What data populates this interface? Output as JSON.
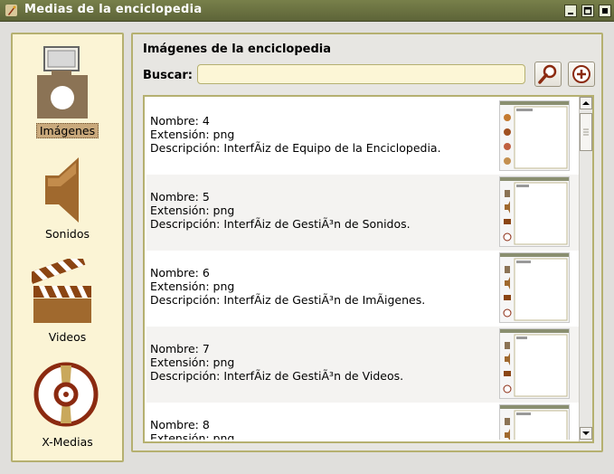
{
  "window": {
    "title": "Medias de la enciclopedia"
  },
  "sidebar": {
    "items": [
      {
        "label": "Imágenes",
        "icon": "camera-icon",
        "active": true
      },
      {
        "label": "Sonidos",
        "icon": "speaker-icon",
        "active": false
      },
      {
        "label": "Videos",
        "icon": "clapperboard-icon",
        "active": false
      },
      {
        "label": "X-Medias",
        "icon": "disc-icon",
        "active": false
      }
    ]
  },
  "main": {
    "title": "Imágenes de la enciclopedia",
    "search": {
      "label": "Buscar:",
      "value": "",
      "search_icon": "search-icon",
      "add_icon": "add-icon"
    },
    "list": [
      {
        "name": "Nombre: 4",
        "ext": "Extensión: png",
        "desc": "Descripción: InterfÃiz de Equipo de la Enciclopedia."
      },
      {
        "name": "Nombre: 5",
        "ext": "Extensión: png",
        "desc": "Descripción: InterfÃiz de GestiÃ³n de Sonidos."
      },
      {
        "name": "Nombre: 6",
        "ext": "Extensión: png",
        "desc": "Descripción: InterfÃiz de GestiÃ³n de ImÃigenes."
      },
      {
        "name": "Nombre: 7",
        "ext": "Extensión: png",
        "desc": "Descripción: InterfÃiz de GestiÃ³n de Videos."
      },
      {
        "name": "Nombre: 8",
        "ext": "Extensión: png",
        "desc": ""
      }
    ]
  },
  "colors": {
    "titlebar": "#6b7242",
    "border": "#b5b070",
    "sidebar_bg": "#fbf4d5",
    "accent_brown": "#8b5a2b"
  }
}
